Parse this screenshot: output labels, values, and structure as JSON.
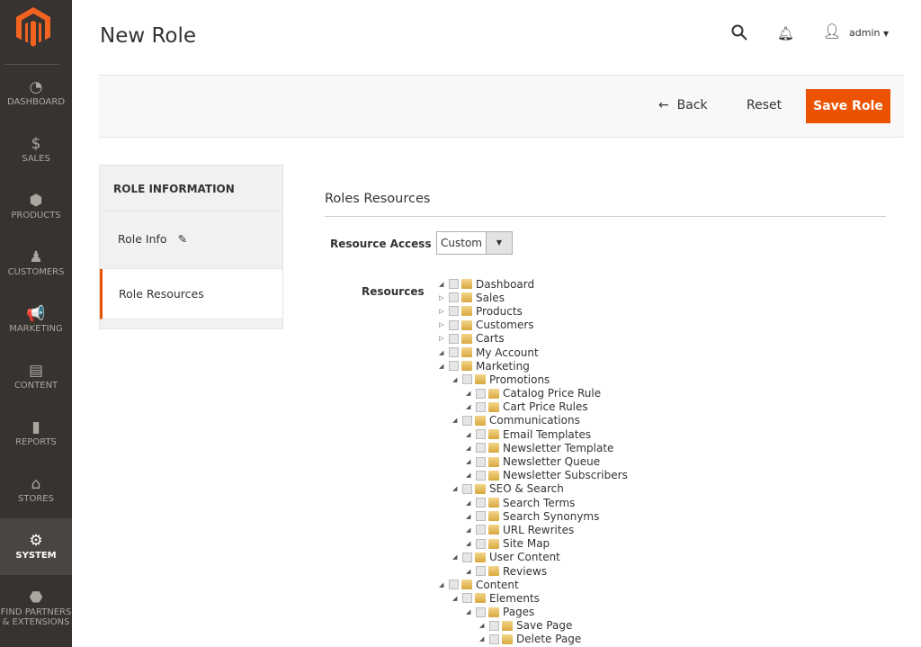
{
  "nav": {
    "items": [
      {
        "label": "DASHBOARD",
        "icon": "dashboard-icon",
        "glyph": "◔"
      },
      {
        "label": "SALES",
        "icon": "dollar-icon",
        "glyph": "$"
      },
      {
        "label": "PRODUCTS",
        "icon": "box-icon",
        "glyph": "⬢"
      },
      {
        "label": "CUSTOMERS",
        "icon": "person-icon",
        "glyph": "♟"
      },
      {
        "label": "MARKETING",
        "icon": "megaphone-icon",
        "glyph": "📢"
      },
      {
        "label": "CONTENT",
        "icon": "layout-icon",
        "glyph": "▤"
      },
      {
        "label": "REPORTS",
        "icon": "bar-chart-icon",
        "glyph": "▮"
      },
      {
        "label": "STORES",
        "icon": "store-icon",
        "glyph": "⌂"
      },
      {
        "label": "SYSTEM",
        "icon": "gear-icon",
        "glyph": "⚙",
        "active": true
      },
      {
        "label": "FIND PARTNERS & EXTENSIONS",
        "icon": "brick-icon",
        "glyph": "⬣"
      }
    ]
  },
  "header": {
    "title": "New Role",
    "user": "admin"
  },
  "actions": {
    "back": "Back",
    "reset": "Reset",
    "save": "Save Role"
  },
  "tabs": {
    "heading": "ROLE INFORMATION",
    "items": [
      "Role Info",
      "Role Resources"
    ]
  },
  "section": {
    "title": "Roles Resources",
    "resource_access_label": "Resource Access",
    "resource_access_value": "Custom",
    "resources_label": "Resources"
  },
  "colors": {
    "accent": "#eb5202",
    "nav_bg": "#373330"
  },
  "tree": [
    {
      "label": "Dashboard",
      "level": 0,
      "open": true
    },
    {
      "label": "Sales",
      "level": 0,
      "open": false
    },
    {
      "label": "Products",
      "level": 0,
      "open": false
    },
    {
      "label": "Customers",
      "level": 0,
      "open": false
    },
    {
      "label": "Carts",
      "level": 0,
      "open": false
    },
    {
      "label": "My Account",
      "level": 0,
      "open": true
    },
    {
      "label": "Marketing",
      "level": 0,
      "open": true
    },
    {
      "label": "Promotions",
      "level": 1,
      "open": true
    },
    {
      "label": "Catalog Price Rule",
      "level": 2,
      "open": true
    },
    {
      "label": "Cart Price Rules",
      "level": 2,
      "open": true
    },
    {
      "label": "Communications",
      "level": 1,
      "open": true
    },
    {
      "label": "Email Templates",
      "level": 2,
      "open": true
    },
    {
      "label": "Newsletter Template",
      "level": 2,
      "open": true
    },
    {
      "label": "Newsletter Queue",
      "level": 2,
      "open": true
    },
    {
      "label": "Newsletter Subscribers",
      "level": 2,
      "open": true
    },
    {
      "label": "SEO & Search",
      "level": 1,
      "open": true
    },
    {
      "label": "Search Terms",
      "level": 2,
      "open": true
    },
    {
      "label": "Search Synonyms",
      "level": 2,
      "open": true
    },
    {
      "label": "URL Rewrites",
      "level": 2,
      "open": true
    },
    {
      "label": "Site Map",
      "level": 2,
      "open": true
    },
    {
      "label": "User Content",
      "level": 1,
      "open": true
    },
    {
      "label": "Reviews",
      "level": 2,
      "open": true
    },
    {
      "label": "Content",
      "level": 0,
      "open": true
    },
    {
      "label": "Elements",
      "level": 1,
      "open": true
    },
    {
      "label": "Pages",
      "level": 2,
      "open": true
    },
    {
      "label": "Save Page",
      "level": 3,
      "open": true
    },
    {
      "label": "Delete Page",
      "level": 3,
      "open": true
    }
  ]
}
